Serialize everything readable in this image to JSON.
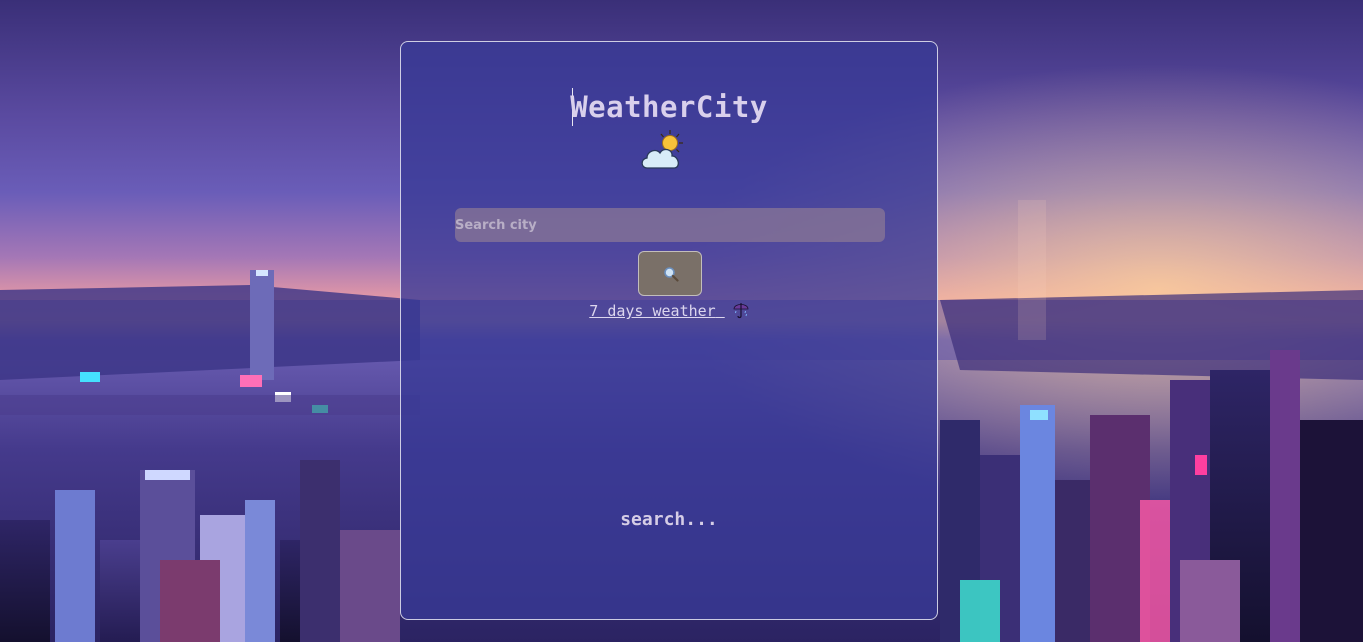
{
  "app": {
    "title": "WeatherCity",
    "title_icon": "sun-behind-cloud-icon"
  },
  "search": {
    "placeholder": "Search city",
    "value": "",
    "button_icon": "magnifier-icon"
  },
  "week_link": {
    "label": "7 days weather",
    "icon": "umbrella-icon"
  },
  "status": {
    "text": "search..."
  },
  "colors": {
    "card": "#383a96",
    "title": "#d9d0ec",
    "input_bg": "#8c7896",
    "button_bg": "#7a7068"
  }
}
